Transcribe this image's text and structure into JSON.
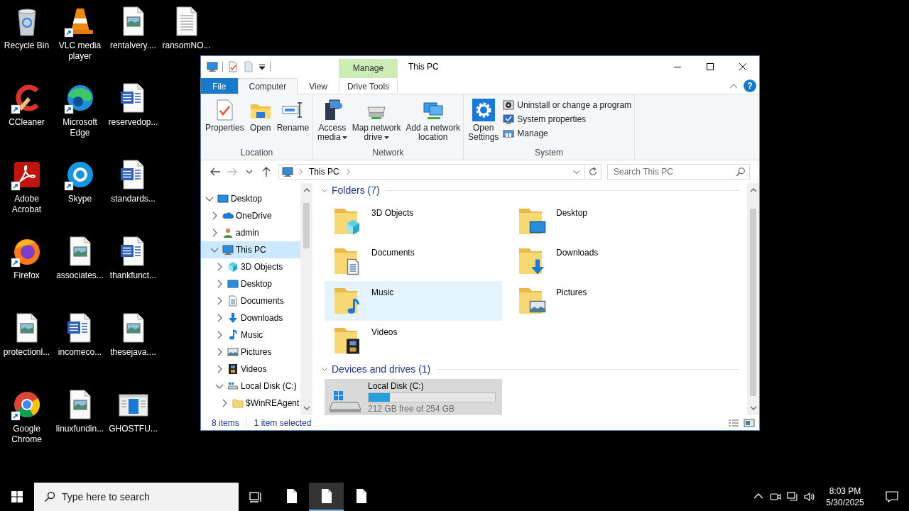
{
  "desktop_icons": [
    {
      "label": "Recycle Bin",
      "kind": "recycle",
      "shortcut": false
    },
    {
      "label": "CCleaner",
      "kind": "ccleaner",
      "shortcut": true
    },
    {
      "label": "Adobe Acrobat",
      "kind": "acrobat",
      "shortcut": true
    },
    {
      "label": "Firefox",
      "kind": "firefox",
      "shortcut": true
    },
    {
      "label": "protectionl...",
      "kind": "image",
      "shortcut": false
    },
    {
      "label": "Google Chrome",
      "kind": "chrome",
      "shortcut": true
    },
    {
      "label": "VLC media player",
      "kind": "vlc",
      "shortcut": true
    },
    {
      "label": "Microsoft Edge",
      "kind": "edge",
      "shortcut": true
    },
    {
      "label": "Skype",
      "kind": "skype",
      "shortcut": true
    },
    {
      "label": "associates...",
      "kind": "image",
      "shortcut": false
    },
    {
      "label": "incomeco...",
      "kind": "word",
      "shortcut": false
    },
    {
      "label": "linuxfundin...",
      "kind": "image",
      "shortcut": false
    },
    {
      "label": "rentalvery....",
      "kind": "image",
      "shortcut": false
    },
    {
      "label": "reservedop...",
      "kind": "word",
      "shortcut": false
    },
    {
      "label": "standards...",
      "kind": "word",
      "shortcut": false
    },
    {
      "label": "thankfunct...",
      "kind": "word",
      "shortcut": false
    },
    {
      "label": "thesejava....",
      "kind": "image",
      "shortcut": false
    },
    {
      "label": "GHOSTFU...",
      "kind": "app",
      "shortcut": false
    },
    {
      "label": "ransomNO...",
      "kind": "text",
      "shortcut": false
    }
  ],
  "explorer": {
    "context_header": "Manage",
    "title": "This PC",
    "tabs": [
      {
        "label": "File",
        "kind": "file",
        "selected": false
      },
      {
        "label": "Computer",
        "kind": "main",
        "selected": true
      },
      {
        "label": "View",
        "kind": "main",
        "selected": false
      },
      {
        "label": "Drive Tools",
        "kind": "context",
        "selected": false
      }
    ],
    "help": "?",
    "ribbon_groups": [
      {
        "label": "Location",
        "commands": [
          {
            "label": "Properties",
            "kind": "properties",
            "dropdown": false
          },
          {
            "label": "Open",
            "kind": "open",
            "dropdown": false
          },
          {
            "label": "Rename",
            "kind": "rename",
            "dropdown": false
          }
        ]
      },
      {
        "label": "Network",
        "commands": [
          {
            "label": "Access\nmedia",
            "kind": "media",
            "dropdown": true
          },
          {
            "label": "Map network\ndrive",
            "kind": "mapdrive",
            "dropdown": true
          },
          {
            "label": "Add a network\nlocation",
            "kind": "addlocation",
            "dropdown": false
          }
        ]
      },
      {
        "label": "System",
        "commands": [
          {
            "label": "Open\nSettings",
            "kind": "settings",
            "dropdown": false
          },
          {
            "label": "Uninstall or change a program",
            "kind": "uninstall",
            "dropdown": false
          },
          {
            "label": "System properties",
            "kind": "sysprops",
            "dropdown": false
          },
          {
            "label": "Manage",
            "kind": "manage",
            "dropdown": false
          }
        ]
      }
    ],
    "navigation": {
      "back_enabled": true,
      "forward_enabled": false
    },
    "address": {
      "path": "This PC"
    },
    "search": {
      "placeholder": "Search This PC"
    },
    "nav_tree": [
      {
        "label": "Desktop",
        "kind": "desktop",
        "expanded": true,
        "selected": false,
        "children": [
          {
            "label": "OneDrive",
            "kind": "onedrive",
            "expanded": false,
            "selected": false
          },
          {
            "label": "admin",
            "kind": "user",
            "expanded": false,
            "selected": false
          },
          {
            "label": "This PC",
            "kind": "pc",
            "expanded": true,
            "selected": true,
            "children": [
              {
                "label": "3D Objects",
                "kind": "objects",
                "expanded": false,
                "selected": false
              },
              {
                "label": "Desktop",
                "kind": "desktop",
                "expanded": false,
                "selected": false
              },
              {
                "label": "Documents",
                "kind": "documents",
                "expanded": false,
                "selected": false
              },
              {
                "label": "Downloads",
                "kind": "downloads",
                "expanded": false,
                "selected": false
              },
              {
                "label": "Music",
                "kind": "music",
                "expanded": false,
                "selected": false
              },
              {
                "label": "Pictures",
                "kind": "pictures",
                "expanded": false,
                "selected": false
              },
              {
                "label": "Videos",
                "kind": "videos",
                "expanded": false,
                "selected": false
              },
              {
                "label": "Local Disk (C:)",
                "kind": "drive",
                "expanded": true,
                "selected": false,
                "children": [
                  {
                    "label": "$WinREAgent",
                    "kind": "folder",
                    "expanded": false,
                    "selected": false
                  }
                ]
              }
            ]
          }
        ]
      }
    ],
    "sections": [
      {
        "title": "Folders (7)",
        "kind": "folders",
        "expanded": true,
        "items": [
          {
            "label": "3D Objects",
            "kind": "objects",
            "hovered": false
          },
          {
            "label": "Desktop",
            "kind": "desktop",
            "hovered": false
          },
          {
            "label": "Documents",
            "kind": "documents",
            "hovered": false
          },
          {
            "label": "Downloads",
            "kind": "downloads",
            "hovered": false
          },
          {
            "label": "Music",
            "kind": "music",
            "hovered": true
          },
          {
            "label": "Pictures",
            "kind": "pictures",
            "hovered": false
          },
          {
            "label": "Videos",
            "kind": "videos",
            "hovered": false
          }
        ]
      },
      {
        "title": "Devices and drives (1)",
        "kind": "drives",
        "expanded": true,
        "items": [
          {
            "label": "Local Disk (C:)",
            "kind": "drive",
            "selected": true,
            "level": 0.17,
            "detail": "212 GB free of 254 GB"
          }
        ]
      }
    ],
    "status_bar": {
      "item_count": "8 items",
      "selection": "1 item selected"
    }
  },
  "taskbar": {
    "search_placeholder": "Type here to search",
    "apps": [
      {
        "active": false
      },
      {
        "active": true
      },
      {
        "active": false
      }
    ],
    "time": "8:03 PM",
    "date": "5/30/2025"
  }
}
